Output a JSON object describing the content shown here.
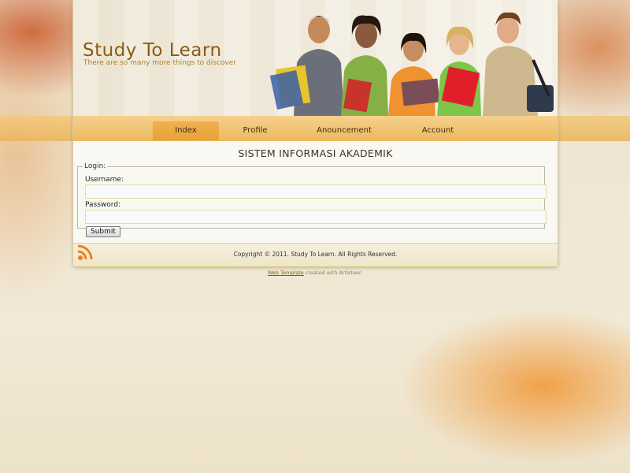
{
  "header": {
    "site_title": "Study To Learn",
    "site_slogan": "There are so many more things to discover"
  },
  "nav": {
    "items": [
      {
        "label": "Index",
        "active": true
      },
      {
        "label": "Profile",
        "active": false
      },
      {
        "label": "Anouncement",
        "active": false
      },
      {
        "label": "Account",
        "active": false
      }
    ]
  },
  "content": {
    "heading": "SISTEM INFORMASI AKADEMIK",
    "login": {
      "legend": "Login:",
      "username_label": "Username:",
      "username_value": "",
      "password_label": "Password:",
      "password_value": "",
      "submit_label": "Submit"
    }
  },
  "footer": {
    "copyright": "Copyright © 2011. Study To Learn. All Rights Reserved.",
    "rss_icon": "rss-icon"
  },
  "credit": {
    "link_text": "Web Template",
    "suffix": " created with Artisteer."
  },
  "colors": {
    "accent": "#ecb95f",
    "title": "#8a5b14",
    "active_tab": "#e8a23a"
  }
}
